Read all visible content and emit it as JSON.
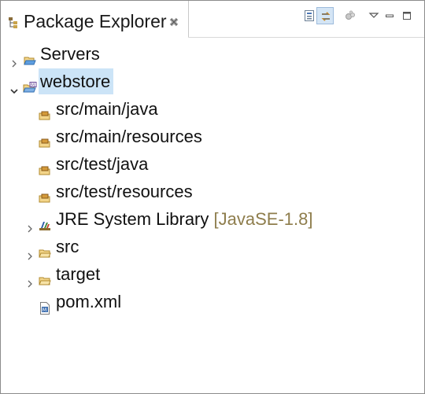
{
  "view": {
    "title": "Package Explorer",
    "toolbar": {
      "collapse_all": "collapse-all",
      "link_with_editor": "link-with-editor",
      "focus_task": "focus-task",
      "view_menu": "view-menu",
      "minimize": "minimize",
      "maximize": "maximize"
    }
  },
  "tree": {
    "servers": "Servers",
    "webstore": "webstore",
    "src_main_java": "src/main/java",
    "src_main_resources": "src/main/resources",
    "src_test_java": "src/test/java",
    "src_test_resources": "src/test/resources",
    "jre_library": "JRE System Library",
    "jre_version": "[JavaSE-1.8]",
    "src": "src",
    "target": "target",
    "pom": "pom.xml"
  },
  "colors": {
    "selection": "#cce4f7",
    "decoration": "#8e7d4c",
    "folder": "#e8c46a"
  }
}
